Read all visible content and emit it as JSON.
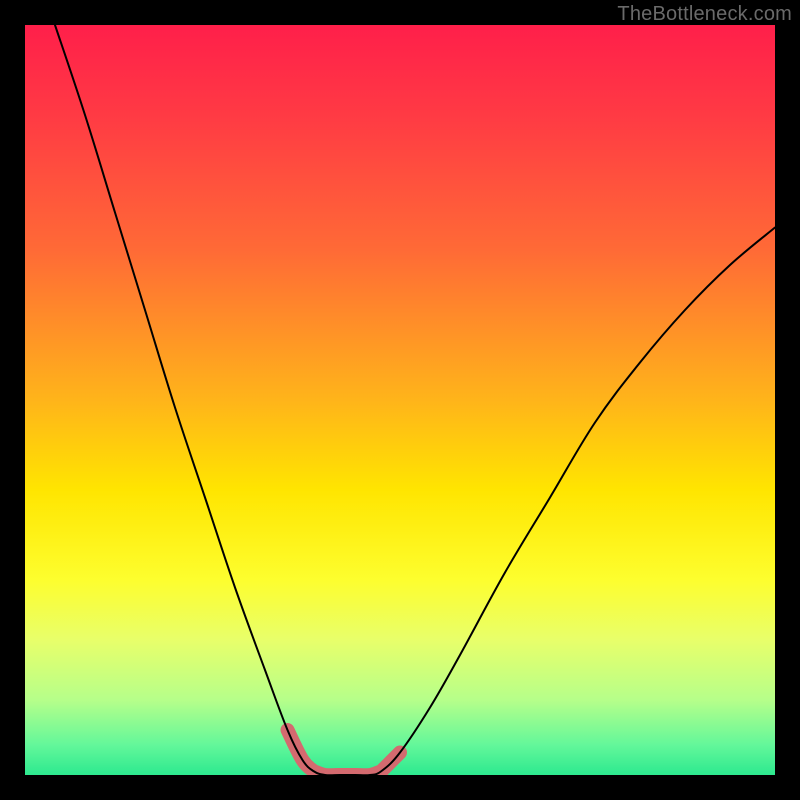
{
  "watermark": "TheBottleneck.com",
  "colors": {
    "frame": "#000000",
    "curve": "#000000",
    "marker": "#d46a6f",
    "gradient_stops": [
      {
        "offset": 0.0,
        "color": "#ff1f4a"
      },
      {
        "offset": 0.12,
        "color": "#ff3a44"
      },
      {
        "offset": 0.3,
        "color": "#ff6a36"
      },
      {
        "offset": 0.5,
        "color": "#ffb41a"
      },
      {
        "offset": 0.62,
        "color": "#ffe500"
      },
      {
        "offset": 0.74,
        "color": "#fdfe2e"
      },
      {
        "offset": 0.82,
        "color": "#e8ff6a"
      },
      {
        "offset": 0.9,
        "color": "#b6ff8a"
      },
      {
        "offset": 0.96,
        "color": "#63f79a"
      },
      {
        "offset": 1.0,
        "color": "#2de98f"
      }
    ]
  },
  "chart_data": {
    "type": "line",
    "title": "",
    "xlabel": "",
    "ylabel": "",
    "xlim": [
      0,
      100
    ],
    "ylim": [
      0,
      100
    ],
    "note": "x is horizontal position (% of plot width), y is bottleneck percentage (0 = best/green floor, 100 = worst/red top). Two monotone branches meeting at the valley.",
    "series": [
      {
        "name": "left-branch",
        "x": [
          4,
          8,
          12,
          16,
          20,
          24,
          28,
          32,
          35,
          37,
          38.5
        ],
        "y": [
          100,
          88,
          75,
          62,
          49,
          37,
          25,
          14,
          6,
          2,
          0.5
        ]
      },
      {
        "name": "valley-floor",
        "x": [
          38.5,
          40,
          42,
          44,
          46,
          47.5
        ],
        "y": [
          0.5,
          0,
          0,
          0,
          0,
          0.5
        ]
      },
      {
        "name": "right-branch",
        "x": [
          47.5,
          50,
          54,
          58,
          64,
          70,
          76,
          82,
          88,
          94,
          100
        ],
        "y": [
          0.5,
          3,
          9,
          16,
          27,
          37,
          47,
          55,
          62,
          68,
          73
        ]
      }
    ],
    "highlight": {
      "note": "Thick salmon segment overlaying the curve around the valley, approximate x range.",
      "x_start": 34,
      "x_end": 50,
      "stroke_width_px": 14
    }
  }
}
